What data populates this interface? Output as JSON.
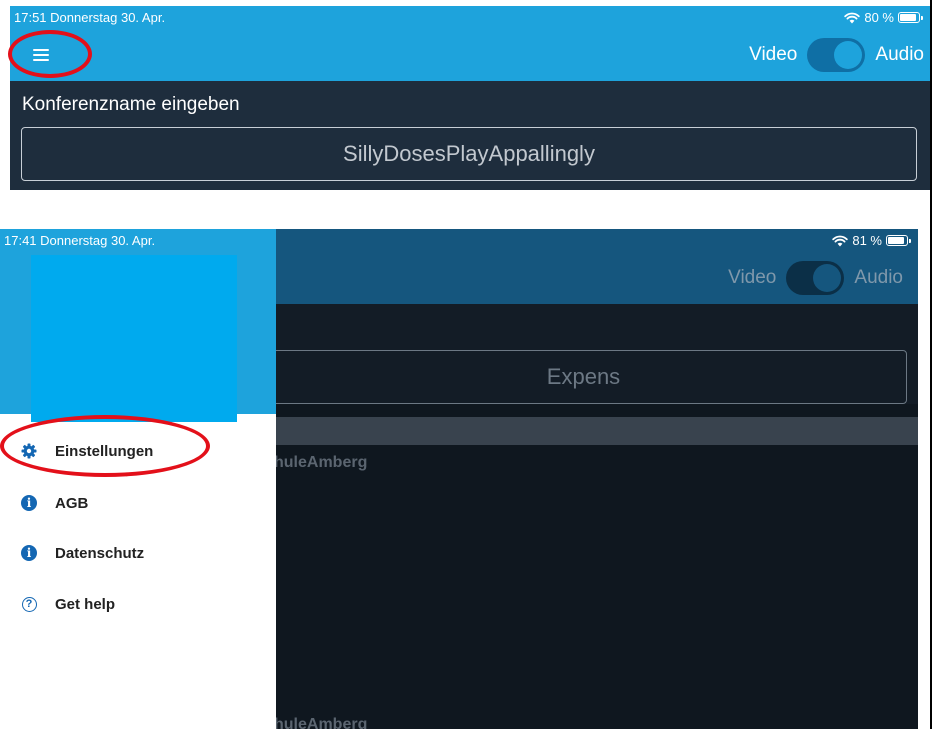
{
  "shot1": {
    "status": {
      "time_date": "17:51  Donnerstag 30. Apr.",
      "battery": "80 %",
      "battery_level": 0.8
    },
    "nav": {
      "video_label": "Video",
      "audio_label": "Audio"
    },
    "conference": {
      "label": "Konferenzname eingeben",
      "value": "SillyDosesPlayAppallingly"
    }
  },
  "shot2": {
    "status": {
      "time_date": "17:41  Donnerstag 30. Apr.",
      "battery": "81 %",
      "battery_level": 0.81
    },
    "nav": {
      "video_label": "Video",
      "audio_label": "Audio"
    },
    "background": {
      "input_value": "Expens",
      "room_1": "huleAmberg",
      "room_2": "huleAmberg"
    },
    "drawer": {
      "items": [
        {
          "label": "Einstellungen",
          "icon": "gear-icon"
        },
        {
          "label": "AGB",
          "icon": "info-icon"
        },
        {
          "label": "Datenschutz",
          "icon": "info-icon"
        },
        {
          "label": "Get help",
          "icon": "help-icon"
        }
      ]
    }
  },
  "colors": {
    "brand_blue": "#1ea3dc",
    "dark_bg": "#1e2d3d",
    "highlight_red": "#e3101a",
    "icon_blue": "#1467b3"
  }
}
